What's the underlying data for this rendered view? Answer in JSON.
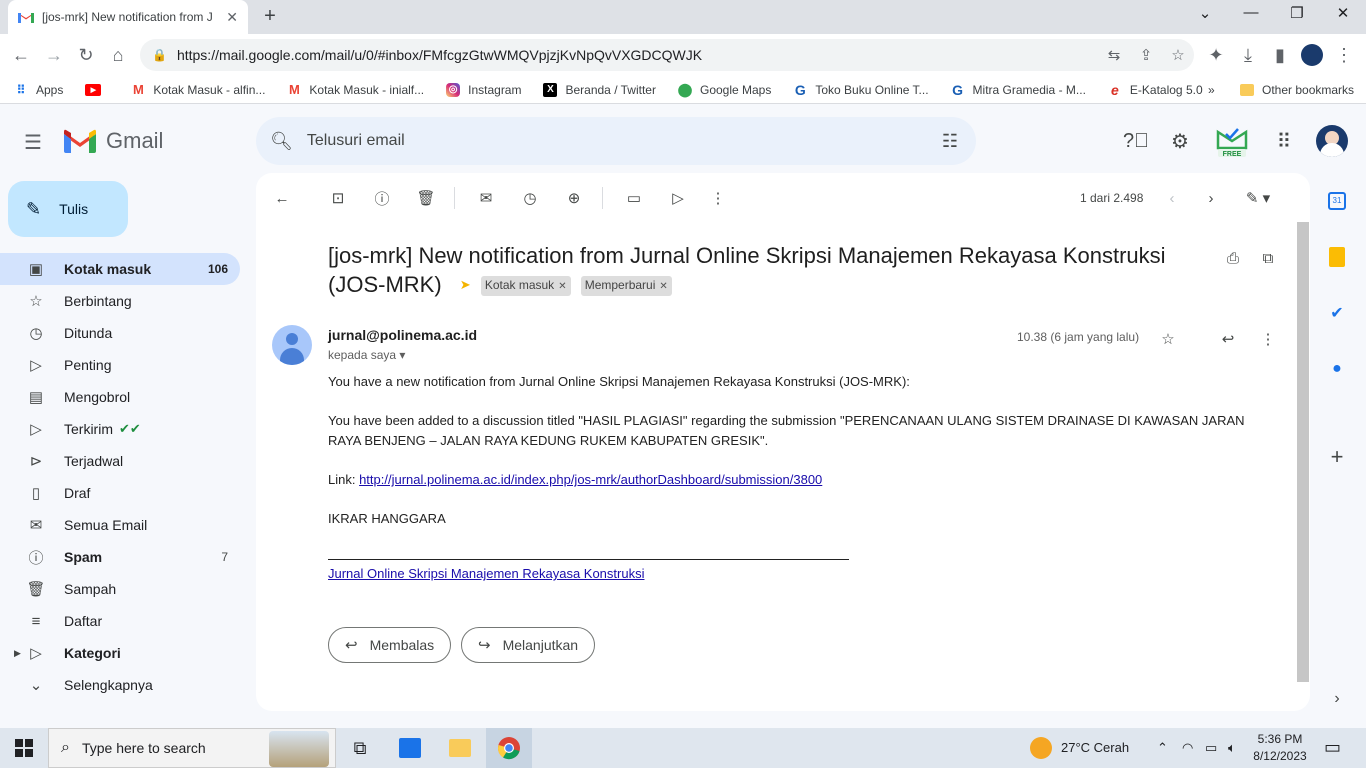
{
  "browser": {
    "tab_title": "[jos-mrk] New notification from J",
    "tab_close": "✕",
    "new_tab": "+",
    "url": "https://mail.google.com/mail/u/0/#inbox/FMfcgzGtwWMQVpjzjKvNpQvVXGDCQWJK",
    "bookmarks": [
      {
        "label": "Apps",
        "icon": "apps-grid-icon"
      },
      {
        "label": "",
        "icon": "youtube-icon"
      },
      {
        "label": "Kotak Masuk - alfin...",
        "icon": "gmail-icon"
      },
      {
        "label": "Kotak Masuk - inialf...",
        "icon": "gmail-icon"
      },
      {
        "label": "Instagram",
        "icon": "instagram-icon"
      },
      {
        "label": "Beranda / Twitter",
        "icon": "x-icon"
      },
      {
        "label": "Google Maps",
        "icon": "maps-pin-icon"
      },
      {
        "label": "Toko Buku Online T...",
        "icon": "g-icon"
      },
      {
        "label": "Mitra Gramedia - M...",
        "icon": "g-icon"
      },
      {
        "label": "E-Katalog 5.0",
        "icon": "e-icon"
      }
    ],
    "bookmarks_more": "»",
    "other_bookmarks": "Other bookmarks"
  },
  "gmail": {
    "brand": "Gmail",
    "search_placeholder": "Telusuri email",
    "compose_label": "Tulis",
    "free_badge": "FREE",
    "nav": [
      {
        "label": "Kotak masuk",
        "count": "106",
        "icon": "inbox-icon",
        "active": true,
        "bold": true
      },
      {
        "label": "Berbintang",
        "count": "",
        "icon": "star-icon"
      },
      {
        "label": "Ditunda",
        "count": "",
        "icon": "clock-icon"
      },
      {
        "label": "Penting",
        "count": "",
        "icon": "label-important-icon"
      },
      {
        "label": "Mengobrol",
        "count": "",
        "icon": "chat-icon"
      },
      {
        "label": "Terkirim",
        "count": "",
        "icon": "send-icon"
      },
      {
        "label": "Terjadwal",
        "count": "",
        "icon": "scheduled-send-icon"
      },
      {
        "label": "Draf",
        "count": "",
        "icon": "draft-icon"
      },
      {
        "label": "Semua Email",
        "count": "",
        "icon": "all-mail-icon"
      },
      {
        "label": "Spam",
        "count": "7",
        "icon": "spam-icon",
        "bold": true
      },
      {
        "label": "Sampah",
        "count": "",
        "icon": "trash-icon"
      },
      {
        "label": "Daftar",
        "count": "",
        "icon": "list-icon"
      },
      {
        "label": "Kategori",
        "count": "",
        "icon": "label-icon",
        "bold": true
      },
      {
        "label": "Selengkapnya",
        "count": "",
        "icon": "chevron-down-icon"
      }
    ],
    "pagination": "1 dari 2.498",
    "email": {
      "subject": "[jos-mrk] New notification from Jurnal Online Skripsi Manajemen Rekayasa Konstruksi (JOS-MRK)",
      "labels": [
        "Kotak masuk",
        "Memperbarui"
      ],
      "sender": "jurnal@polinema.ac.id",
      "to": "kepada saya",
      "time": "10.38 (6 jam yang lalu)",
      "p1": "You have a new notification from Jurnal Online Skripsi Manajemen Rekayasa Konstruksi (JOS-MRK):",
      "p2": "You have been added to a discussion titled \"HASIL PLAGIASI\" regarding the submission \"PERENCANAAN ULANG SISTEM DRAINASE DI KAWASAN JARAN RAYA BENJENG – JALAN RAYA KEDUNG RUKEM KABUPATEN GRESIK\".",
      "link_prefix": "Link: ",
      "link": "http://jurnal.polinema.ac.id/index.php/jos-mrk/authorDashboard/submission/3800",
      "signature": "IKRAR HANGGARA",
      "footer_link": "Jurnal Online Skripsi Manajemen Rekayasa Konstruksi",
      "reply_label": "Membalas",
      "forward_label": "Melanjutkan"
    }
  },
  "taskbar": {
    "search_placeholder": "Type here to search",
    "weather": "27°C  Cerah",
    "time": "5:36 PM",
    "date": "8/12/2023"
  },
  "colors": {
    "gmail_bg": "#f6f8fc",
    "active_nav": "#d3e3fd",
    "compose": "#c2e7ff",
    "link": "#1a0dab"
  }
}
